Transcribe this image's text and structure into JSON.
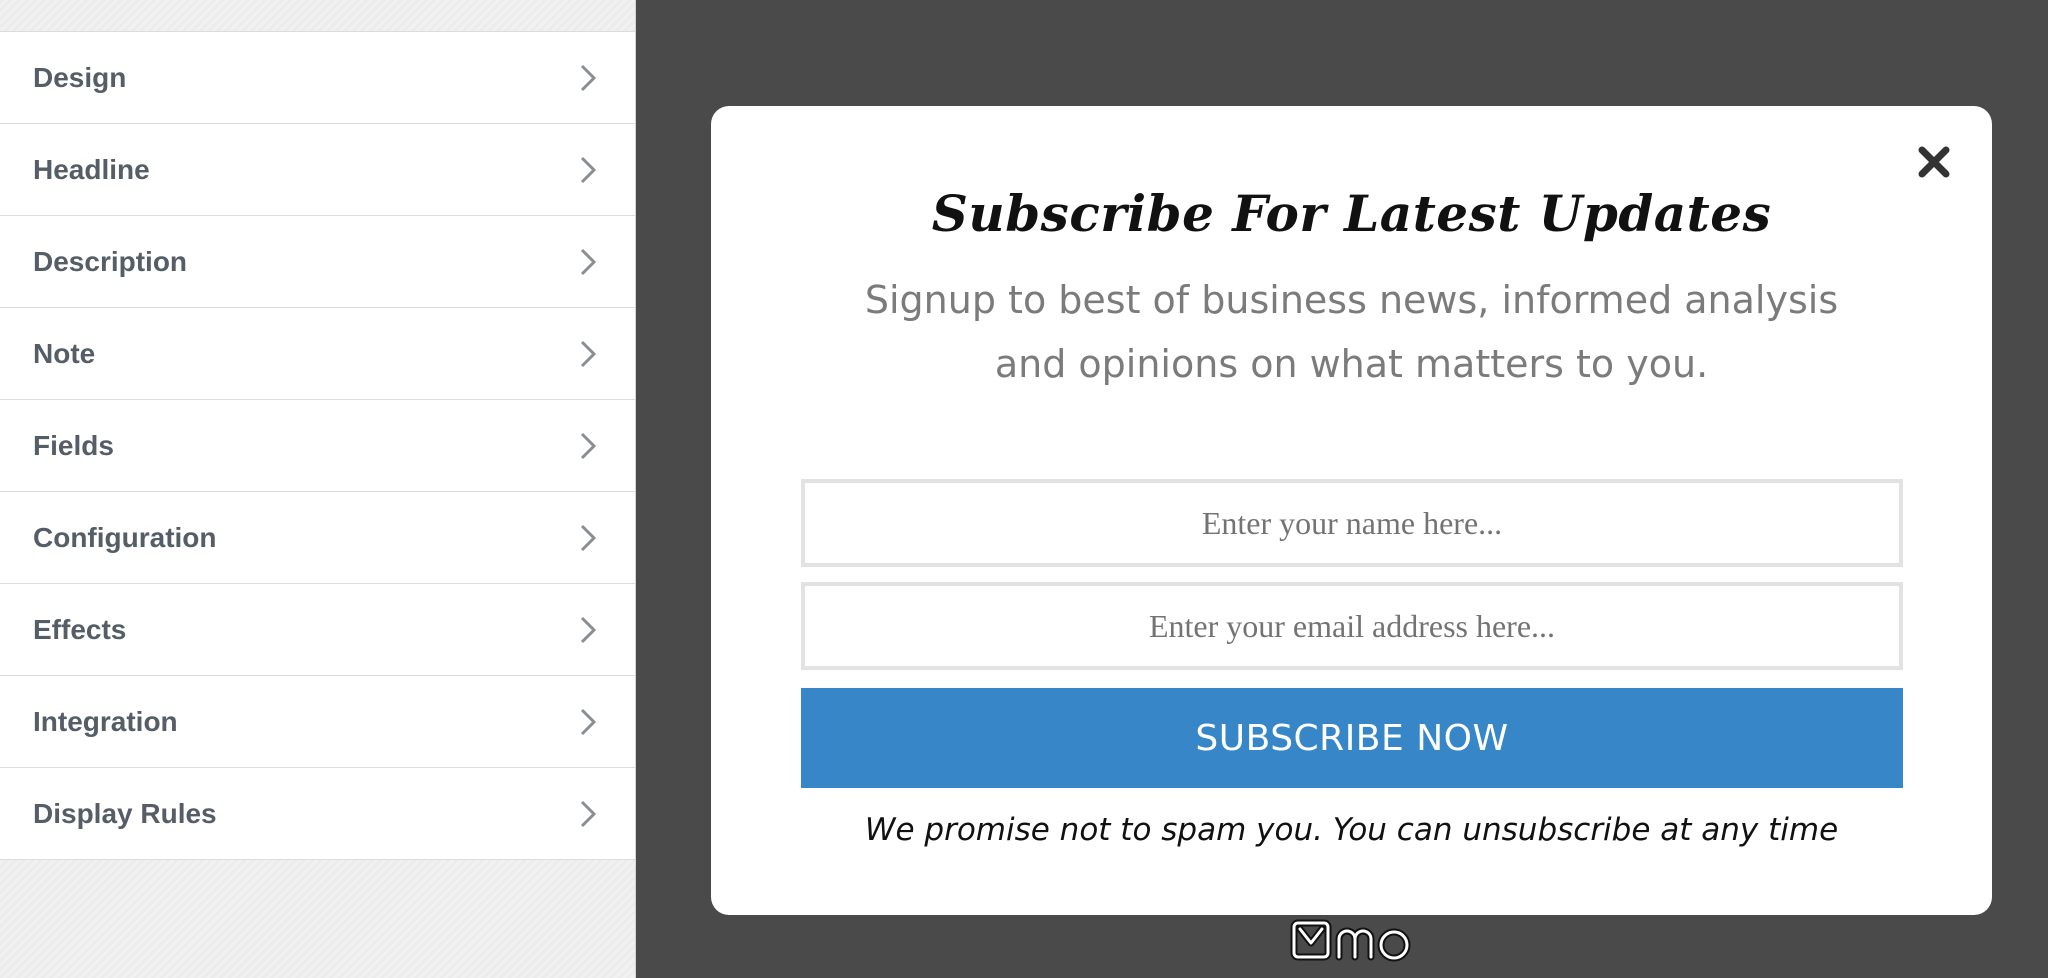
{
  "sidebar": {
    "items": [
      {
        "label": "Design"
      },
      {
        "label": "Headline"
      },
      {
        "label": "Description"
      },
      {
        "label": "Note"
      },
      {
        "label": "Fields"
      },
      {
        "label": "Configuration"
      },
      {
        "label": "Effects"
      },
      {
        "label": "Integration"
      },
      {
        "label": "Display Rules"
      }
    ],
    "item_icon": "chevron-right-icon"
  },
  "popup": {
    "title": "Subscribe For Latest Updates",
    "description": "Signup to best of business news, informed analysis and opinions on what matters to you.",
    "name_placeholder": "Enter your name here...",
    "email_placeholder": "Enter your email address here...",
    "button_label": "SUBSCRIBE NOW",
    "note": "We promise not to spam you. You can unsubscribe at any time",
    "close_icon": "close-icon"
  },
  "brand": {
    "logo_icon": "mo-logo-icon"
  },
  "colors": {
    "preview_background": "#4a4a4a",
    "button_background": "#3787c8",
    "sidebar_label": "#555d66"
  }
}
